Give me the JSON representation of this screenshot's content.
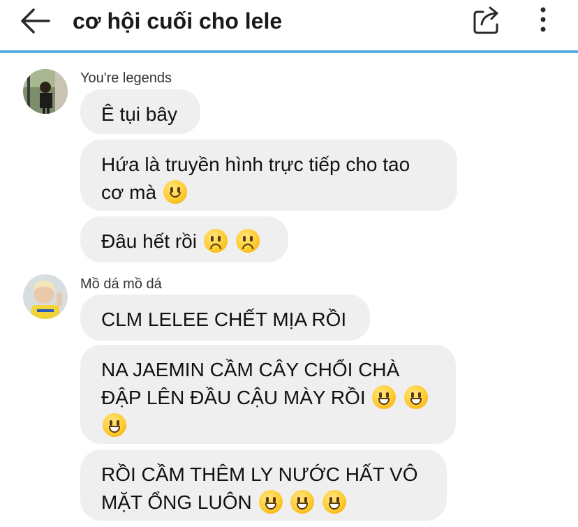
{
  "header": {
    "title": "cơ hội cuối cho lele",
    "back_icon": "arrow-left-icon",
    "share_icon": "share-icon",
    "more_icon": "more-vertical-icon",
    "accent_color": "#5aaee4"
  },
  "groups": [
    {
      "sender": "You're legends",
      "messages": [
        {
          "text": "Ê tụi bây",
          "emojis": []
        },
        {
          "text": "Hứa là truyền hình trực tiếp cho tao cơ mà",
          "emojis": [
            "smile"
          ]
        },
        {
          "text": "Đâu hết rồi",
          "emojis": [
            "frown",
            "frown"
          ]
        }
      ]
    },
    {
      "sender": "Mồ dá mồ dá",
      "messages": [
        {
          "text": "CLM LELEE CHẾT MỊA RỒI",
          "emojis": []
        },
        {
          "text": "NA JAEMIN CẦM CÂY CHỔI CHÀ ĐẬP LÊN ĐẦU CẬU MÀY RỒI",
          "emojis": [
            "grin",
            "grin",
            "grin"
          ]
        },
        {
          "text": "RỒI CẦM THÊM LY NƯỚC HẤT VÔ MẶT ỔNG LUÔN",
          "emojis": [
            "grin",
            "grin",
            "grin"
          ]
        }
      ]
    }
  ]
}
